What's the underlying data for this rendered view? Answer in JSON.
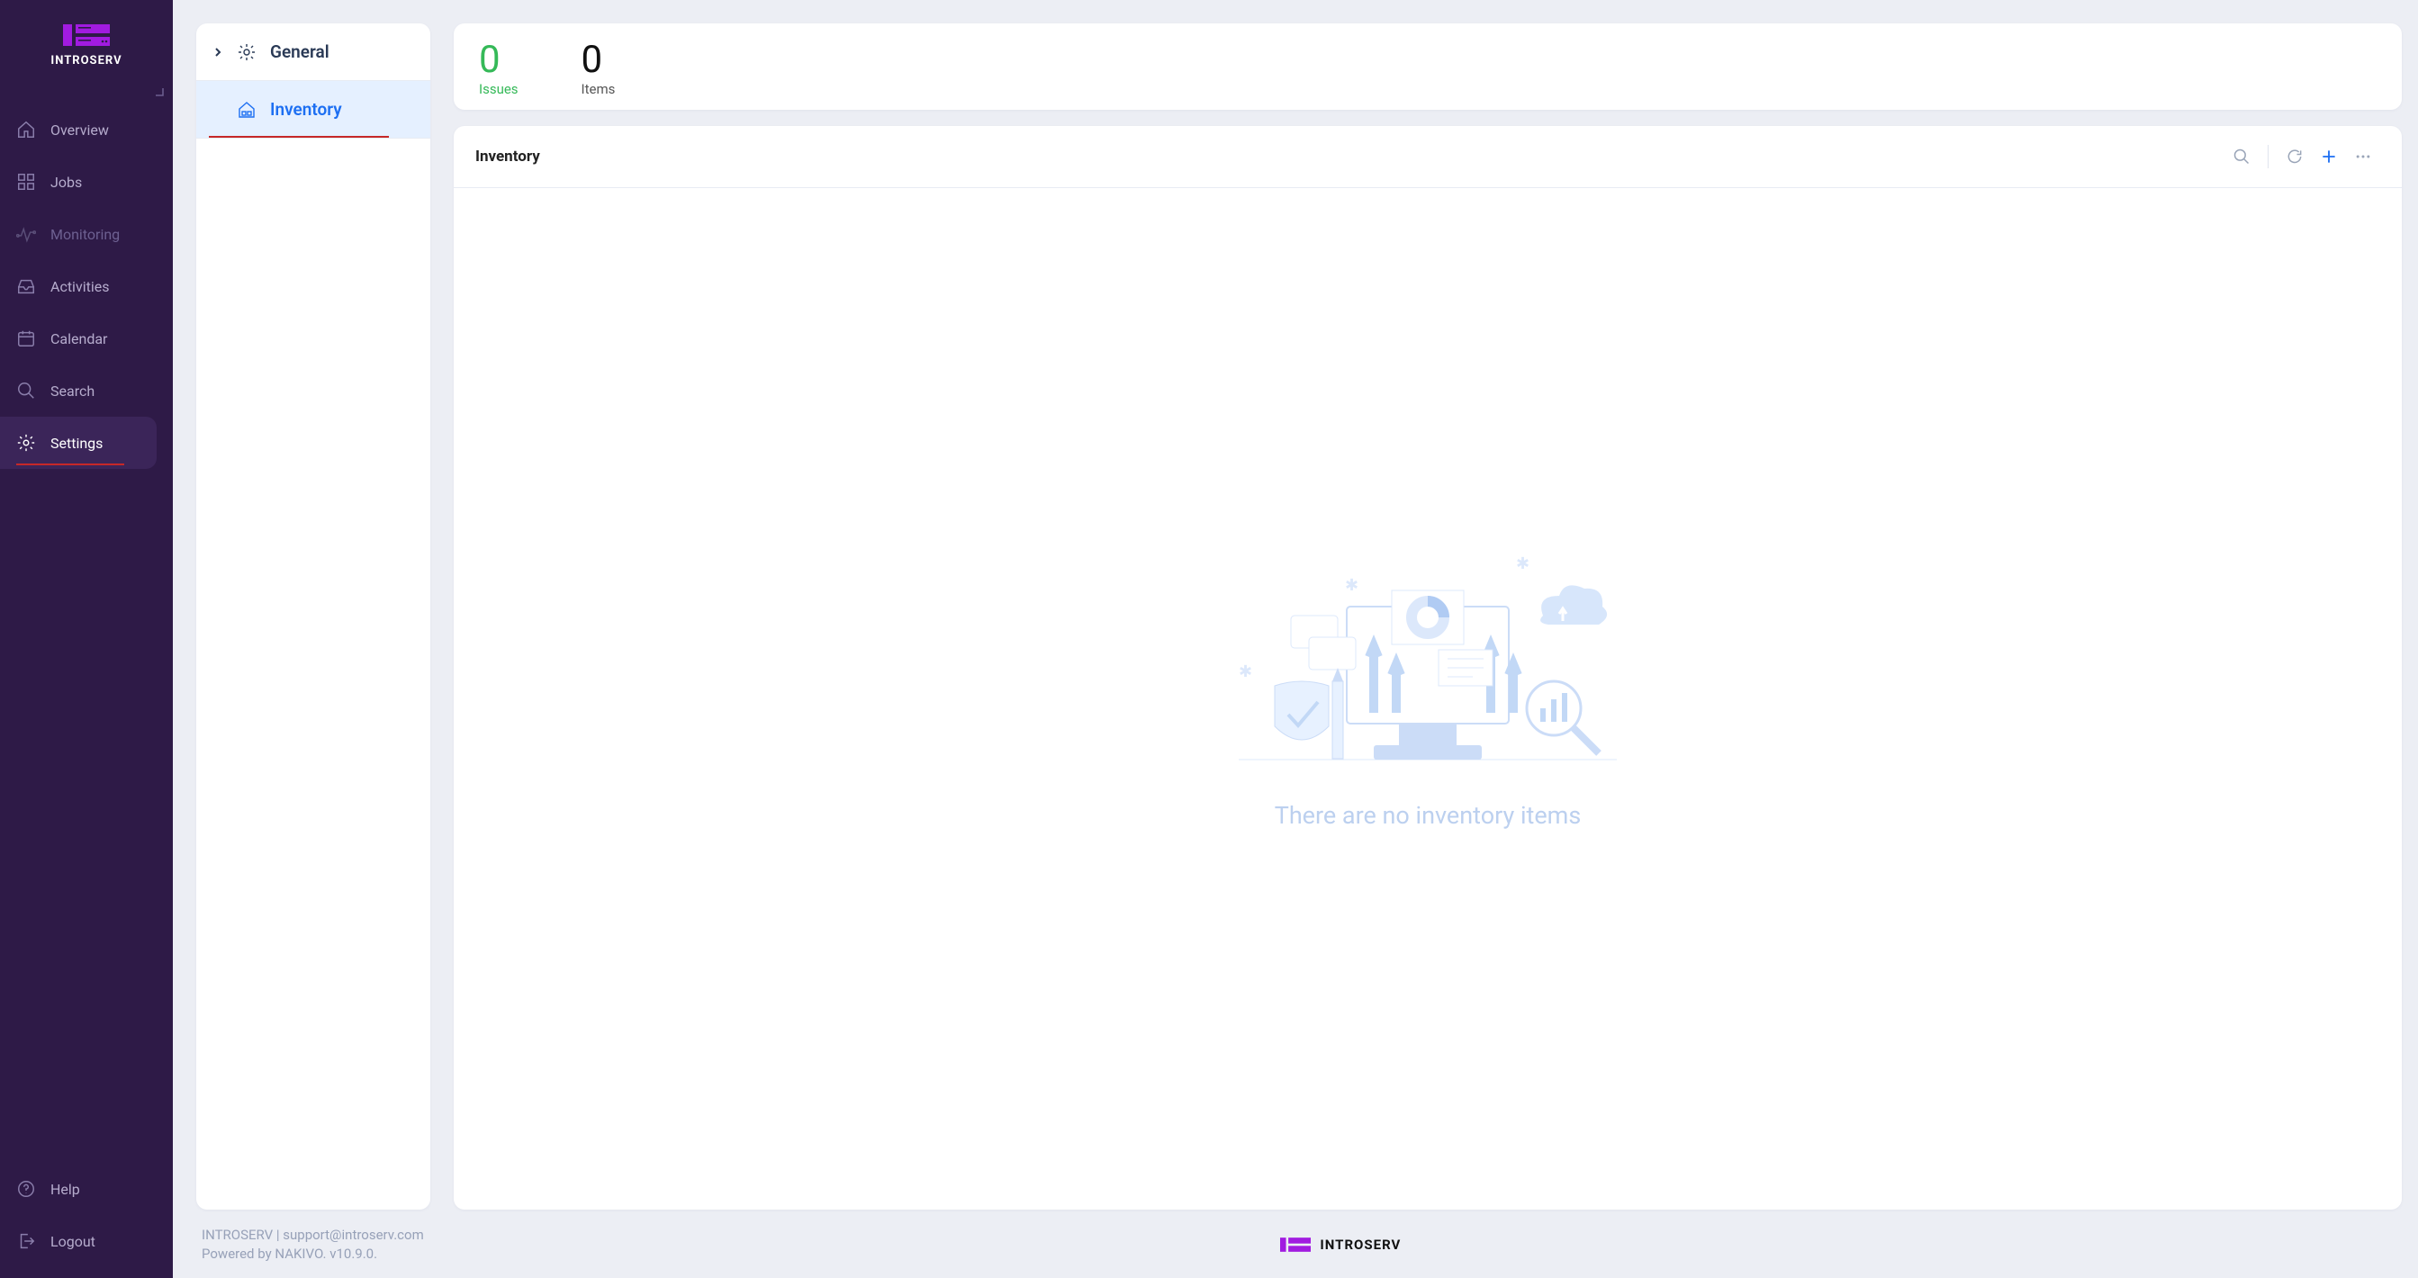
{
  "brand": {
    "name": "INTROSERV"
  },
  "sidebar": {
    "items": [
      {
        "label": "Overview",
        "icon": "house",
        "active": false,
        "muted": false
      },
      {
        "label": "Jobs",
        "icon": "grid",
        "active": false,
        "muted": false
      },
      {
        "label": "Monitoring",
        "icon": "pulse",
        "active": false,
        "muted": true
      },
      {
        "label": "Activities",
        "icon": "inbox",
        "active": false,
        "muted": false
      },
      {
        "label": "Calendar",
        "icon": "calendar",
        "active": false,
        "muted": false
      },
      {
        "label": "Search",
        "icon": "search",
        "active": false,
        "muted": false
      },
      {
        "label": "Settings",
        "icon": "gear",
        "active": true,
        "muted": false
      }
    ],
    "bottom": [
      {
        "label": "Help",
        "icon": "help"
      },
      {
        "label": "Logout",
        "icon": "logout"
      }
    ]
  },
  "subnav": {
    "items": [
      {
        "label": "General",
        "icon": "gear-box",
        "active": false,
        "expandable": true
      },
      {
        "label": "Inventory",
        "icon": "house-box",
        "active": true,
        "expandable": false
      }
    ]
  },
  "stats": {
    "issues": {
      "value": "0",
      "label": "Issues"
    },
    "items": {
      "value": "0",
      "label": "Items"
    }
  },
  "inventory": {
    "title": "Inventory",
    "empty_message": "There are no inventory items"
  },
  "footer": {
    "line1": "INTROSERV | support@introserv.com",
    "line2": "Powered by NAKIVO. v10.9.0.",
    "brand": "INTROSERV"
  }
}
